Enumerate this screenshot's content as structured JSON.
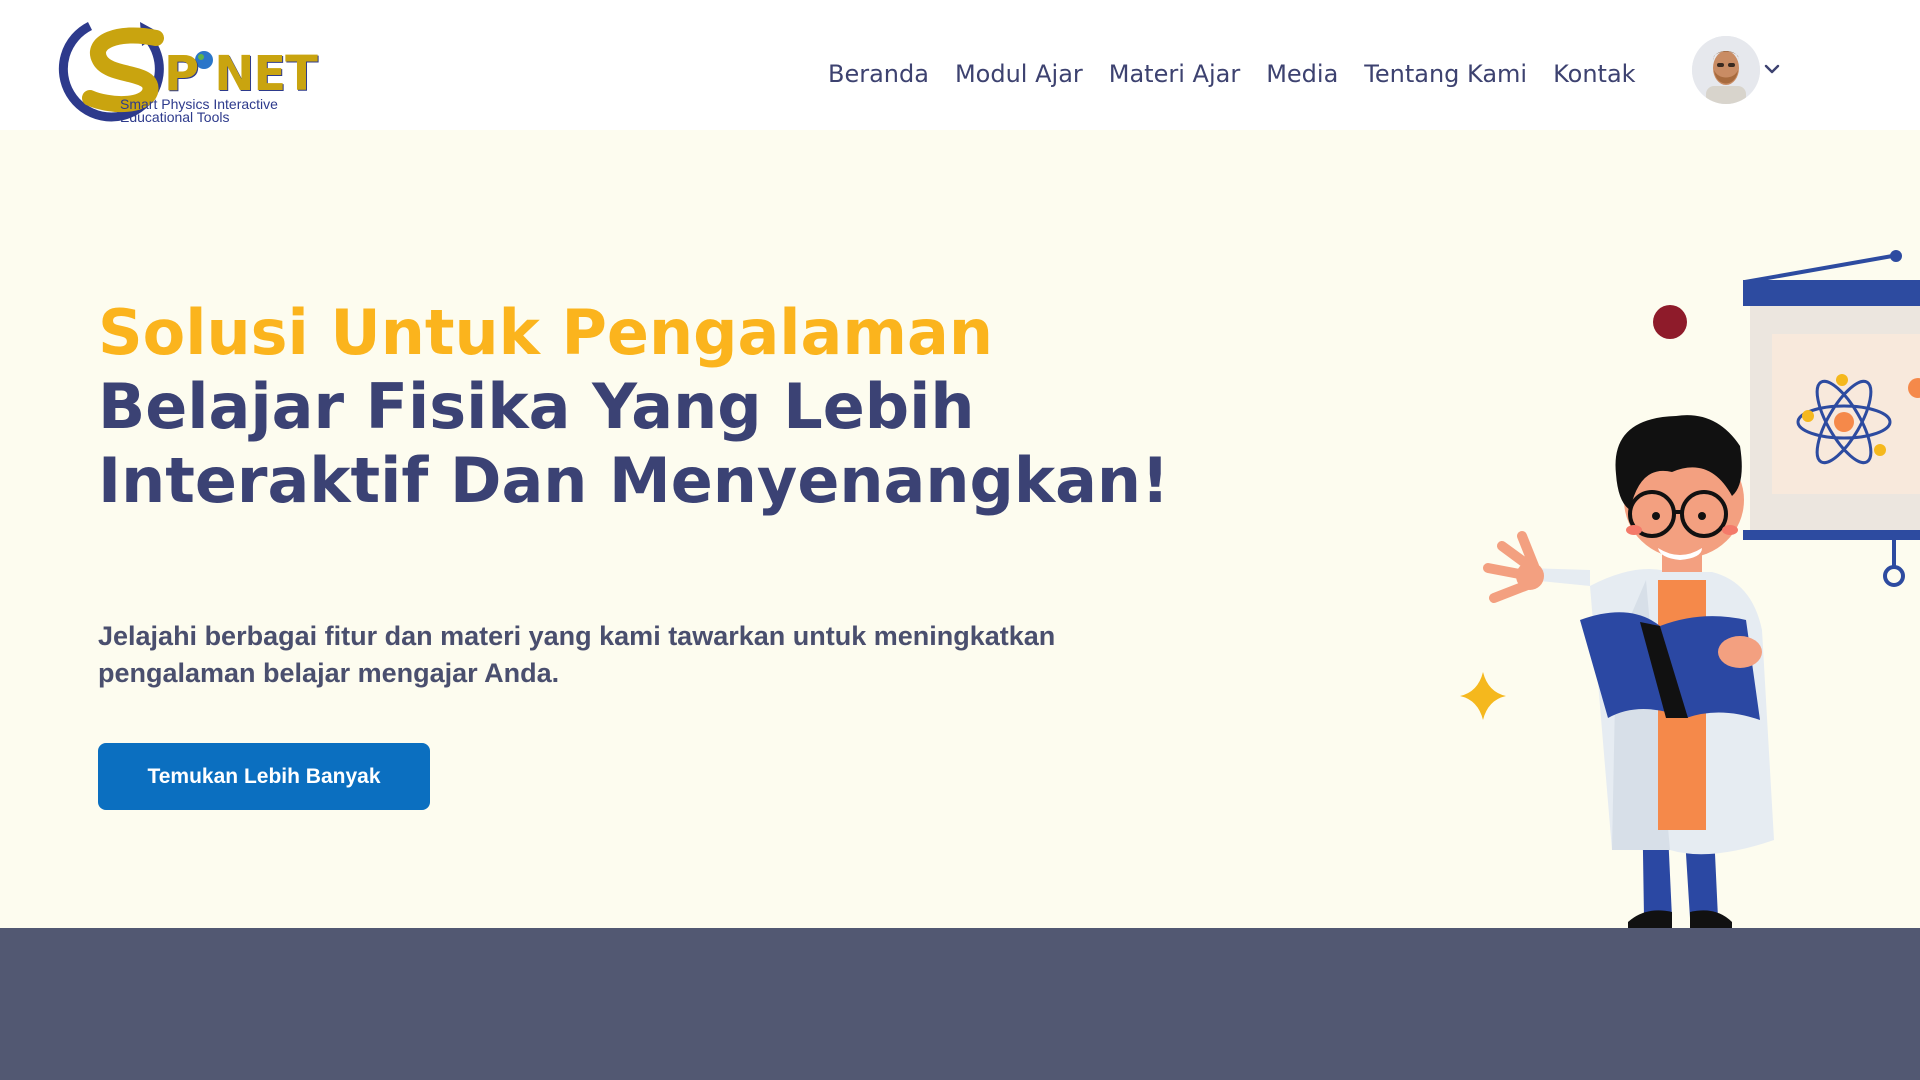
{
  "brand": {
    "name": "SPiNET",
    "tagline_line1": "Smart Physics Interactive",
    "tagline_line2": "Educational Tools"
  },
  "nav": {
    "items": [
      {
        "label": "Beranda"
      },
      {
        "label": "Modul Ajar"
      },
      {
        "label": "Materi Ajar"
      },
      {
        "label": "Media"
      },
      {
        "label": "Tentang Kami"
      },
      {
        "label": "Kontak"
      }
    ]
  },
  "user": {
    "avatar_icon": "user-avatar",
    "menu_icon": "chevron-down-icon"
  },
  "hero": {
    "headline_accent": "Solusi Untuk Pengalaman",
    "headline_rest": " Belajar Fisika Yang Lebih Interaktif Dan Menyenangkan!",
    "description": "Jelajahi berbagai fitur dan materi yang kami tawarkan untuk meningkatkan pengalaman belajar mengajar Anda.",
    "cta_label": "Temukan Lebih Banyak"
  },
  "colors": {
    "accent": "#fbb41d",
    "headline": "#3b4274",
    "cta": "#0b6fc0",
    "hero_bg": "#fdfcef",
    "band": "#525872"
  }
}
